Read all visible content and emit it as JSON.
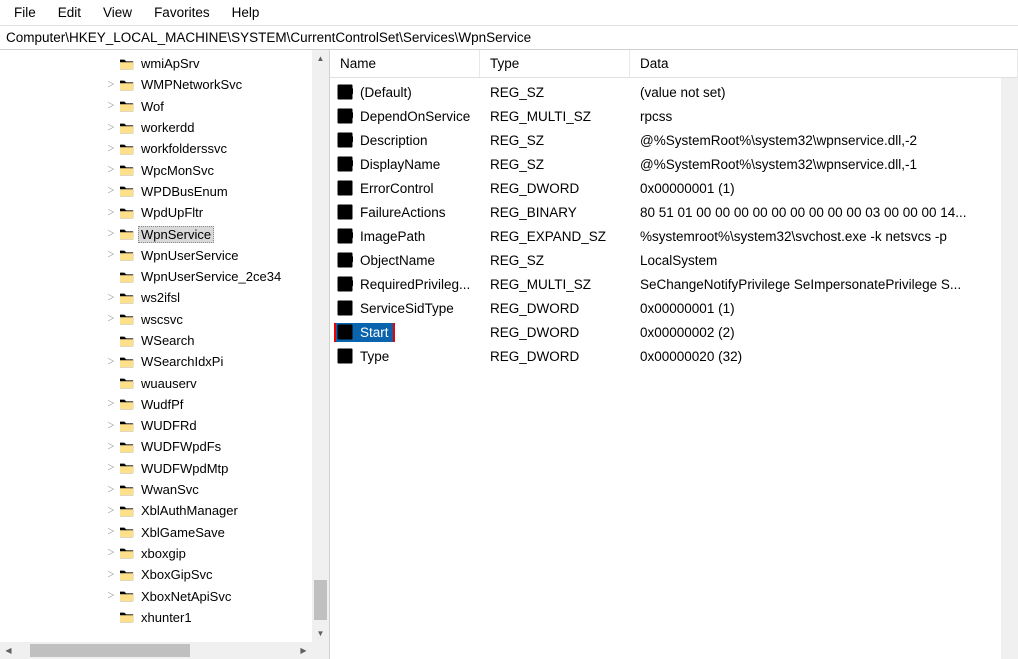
{
  "menu": {
    "file": "File",
    "edit": "Edit",
    "view": "View",
    "favorites": "Favorites",
    "help": "Help"
  },
  "address": "Computer\\HKEY_LOCAL_MACHINE\\SYSTEM\\CurrentControlSet\\Services\\WpnService",
  "columns": {
    "name": "Name",
    "type": "Type",
    "data": "Data"
  },
  "tree": [
    {
      "label": "wmiApSrv",
      "expander": ""
    },
    {
      "label": "WMPNetworkSvc",
      "expander": ">"
    },
    {
      "label": "Wof",
      "expander": ">"
    },
    {
      "label": "workerdd",
      "expander": ">"
    },
    {
      "label": "workfolderssvc",
      "expander": ">"
    },
    {
      "label": "WpcMonSvc",
      "expander": ">"
    },
    {
      "label": "WPDBusEnum",
      "expander": ">"
    },
    {
      "label": "WpdUpFltr",
      "expander": ">"
    },
    {
      "label": "WpnService",
      "expander": ">",
      "selected": true
    },
    {
      "label": "WpnUserService",
      "expander": ">"
    },
    {
      "label": "WpnUserService_2ce34",
      "expander": ""
    },
    {
      "label": "ws2ifsl",
      "expander": ">"
    },
    {
      "label": "wscsvc",
      "expander": ">"
    },
    {
      "label": "WSearch",
      "expander": ""
    },
    {
      "label": "WSearchIdxPi",
      "expander": ">"
    },
    {
      "label": "wuauserv",
      "expander": ""
    },
    {
      "label": "WudfPf",
      "expander": ">"
    },
    {
      "label": "WUDFRd",
      "expander": ">"
    },
    {
      "label": "WUDFWpdFs",
      "expander": ">"
    },
    {
      "label": "WUDFWpdMtp",
      "expander": ">"
    },
    {
      "label": "WwanSvc",
      "expander": ">"
    },
    {
      "label": "XblAuthManager",
      "expander": ">"
    },
    {
      "label": "XblGameSave",
      "expander": ">"
    },
    {
      "label": "xboxgip",
      "expander": ">"
    },
    {
      "label": "XboxGipSvc",
      "expander": ">"
    },
    {
      "label": "XboxNetApiSvc",
      "expander": ">"
    },
    {
      "label": "xhunter1",
      "expander": ""
    }
  ],
  "rows": [
    {
      "icon": "ab",
      "name": "(Default)",
      "type": "REG_SZ",
      "data": "(value not set)"
    },
    {
      "icon": "ab",
      "name": "DependOnService",
      "type": "REG_MULTI_SZ",
      "data": "rpcss"
    },
    {
      "icon": "ab",
      "name": "Description",
      "type": "REG_SZ",
      "data": "@%SystemRoot%\\system32\\wpnservice.dll,-2"
    },
    {
      "icon": "ab",
      "name": "DisplayName",
      "type": "REG_SZ",
      "data": "@%SystemRoot%\\system32\\wpnservice.dll,-1"
    },
    {
      "icon": "bin",
      "name": "ErrorControl",
      "type": "REG_DWORD",
      "data": "0x00000001 (1)"
    },
    {
      "icon": "bin",
      "name": "FailureActions",
      "type": "REG_BINARY",
      "data": "80 51 01 00 00 00 00 00 00 00 00 00 03 00 00 00 14..."
    },
    {
      "icon": "ab",
      "name": "ImagePath",
      "type": "REG_EXPAND_SZ",
      "data": "%systemroot%\\system32\\svchost.exe -k netsvcs -p"
    },
    {
      "icon": "ab",
      "name": "ObjectName",
      "type": "REG_SZ",
      "data": "LocalSystem"
    },
    {
      "icon": "ab",
      "name": "RequiredPrivileg...",
      "type": "REG_MULTI_SZ",
      "data": "SeChangeNotifyPrivilege SeImpersonatePrivilege S..."
    },
    {
      "icon": "bin",
      "name": "ServiceSidType",
      "type": "REG_DWORD",
      "data": "0x00000001 (1)"
    },
    {
      "icon": "bin",
      "name": "Start",
      "type": "REG_DWORD",
      "data": "0x00000002 (2)",
      "highlighted": true
    },
    {
      "icon": "bin",
      "name": "Type",
      "type": "REG_DWORD",
      "data": "0x00000020 (32)"
    }
  ]
}
